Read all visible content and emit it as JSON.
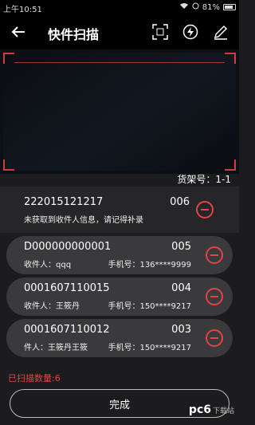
{
  "status_bar": {
    "time": "上午10:51",
    "battery": "81%"
  },
  "toolbar": {
    "title": "快件扫描"
  },
  "shelf": {
    "label": "货架号：1-1"
  },
  "items": [
    {
      "number": "222015121217",
      "code": "006",
      "receiver": "未获取到收件人信息，请记得补录",
      "phone": ""
    },
    {
      "number": "D000000000001",
      "code": "005",
      "receiver": "收件人：qqq",
      "phone": "手机号：136****9999"
    },
    {
      "number": "0001607110015",
      "code": "004",
      "receiver": "收件人：王筱丹",
      "phone": "手机号：150****9217"
    },
    {
      "number": "0001607110012",
      "code": "003",
      "receiver": "件人：王筱丹王筱",
      "phone": "手机号：150****9217"
    }
  ],
  "footer": {
    "scanned_count": "已扫描数量:6",
    "finish_label": "完成"
  },
  "watermark": {
    "logo": "pc6",
    "sub": "下载站"
  },
  "colors": {
    "accent": "#e04444",
    "background": "#1c1c1e",
    "card": "#3a3a3c"
  }
}
